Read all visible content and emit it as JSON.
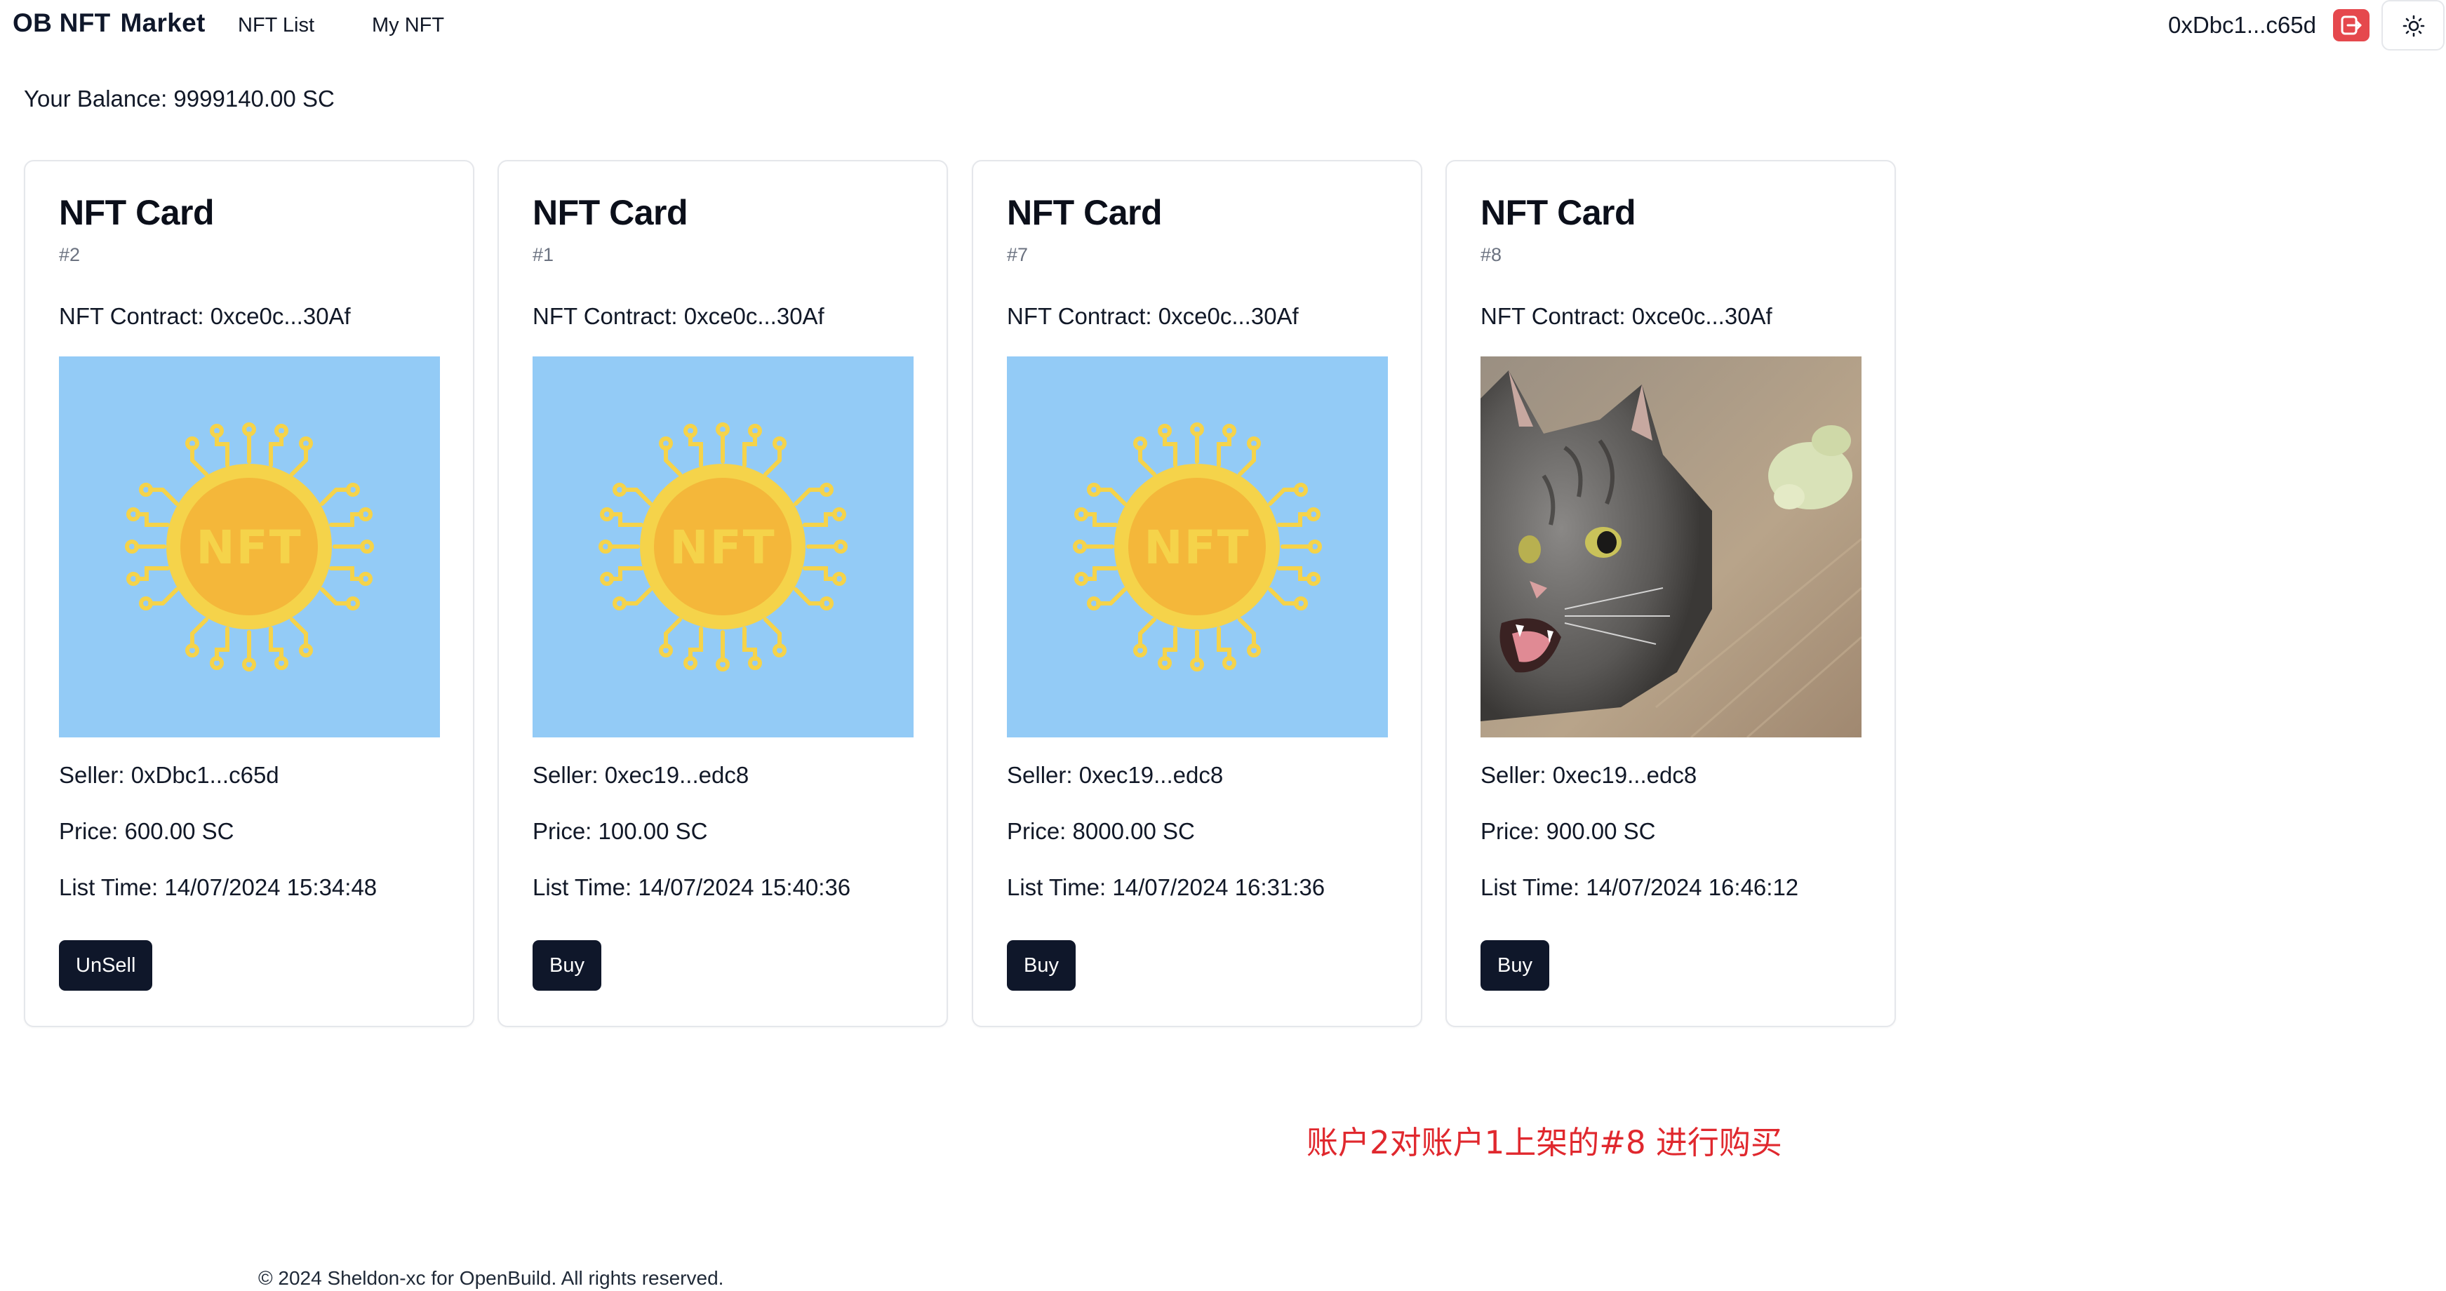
{
  "header": {
    "brand_left": "OB NFT",
    "brand_right": "Market",
    "nav": [
      {
        "label": "NFT List"
      },
      {
        "label": "My NFT"
      }
    ],
    "wallet_address": "0xDbc1...c65d",
    "logout_icon": "logout-icon",
    "theme_icon": "sun-icon"
  },
  "balance": "Your Balance: 9999140.00 SC",
  "cards": [
    {
      "title": "NFT Card",
      "id": "#2",
      "contract": "NFT Contract: 0xce0c...30Af",
      "image": "nft-coin",
      "seller": "Seller: 0xDbc1...c65d",
      "price": "Price: 600.00 SC",
      "list_time": "List Time: 14/07/2024 15:34:48",
      "action": "UnSell"
    },
    {
      "title": "NFT Card",
      "id": "#1",
      "contract": "NFT Contract: 0xce0c...30Af",
      "image": "nft-coin",
      "seller": "Seller: 0xec19...edc8",
      "price": "Price: 100.00 SC",
      "list_time": "List Time: 14/07/2024 15:40:36",
      "action": "Buy"
    },
    {
      "title": "NFT Card",
      "id": "#7",
      "contract": "NFT Contract: 0xce0c...30Af",
      "image": "nft-coin",
      "seller": "Seller: 0xec19...edc8",
      "price": "Price: 8000.00 SC",
      "list_time": "List Time: 14/07/2024 16:31:36",
      "action": "Buy"
    },
    {
      "title": "NFT Card",
      "id": "#8",
      "contract": "NFT Contract: 0xce0c...30Af",
      "image": "cat-photo",
      "seller": "Seller: 0xec19...edc8",
      "price": "Price: 900.00 SC",
      "list_time": "List Time: 14/07/2024 16:46:12",
      "action": "Buy"
    }
  ],
  "annotation": "账户2对账户1上架的#8 进行购买",
  "footer": "© 2024 Sheldon-xc for OpenBuild. All rights reserved.",
  "colors": {
    "primary_button": "#0f172a",
    "logout_button": "#e5484d",
    "nft_background": "#93cbf6",
    "coin": "#f4b73a",
    "annotation": "#e0282e"
  }
}
